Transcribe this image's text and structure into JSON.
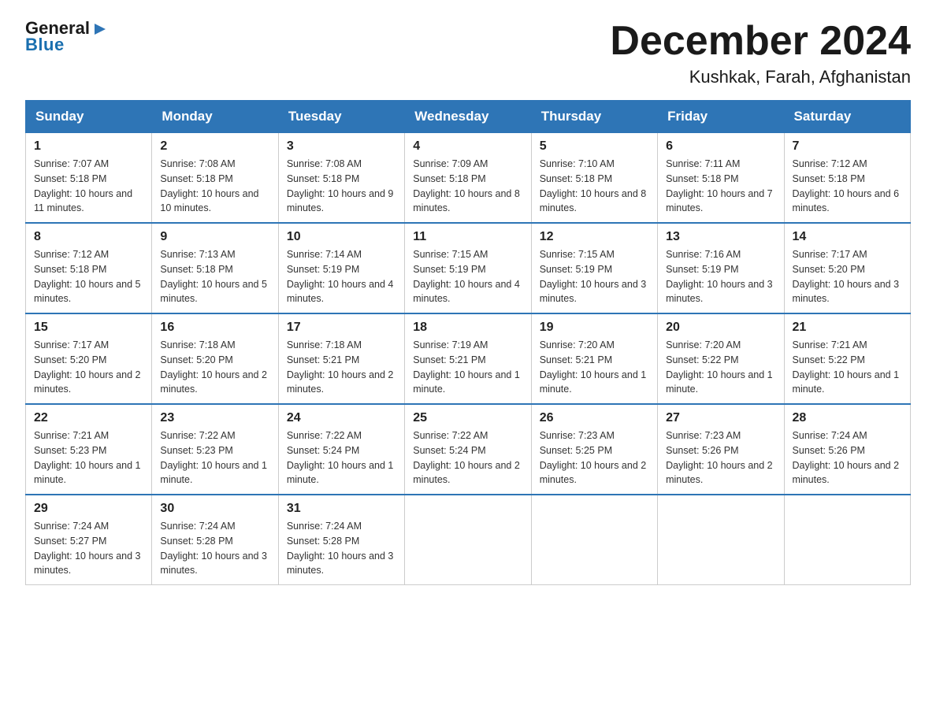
{
  "logo": {
    "name_top": "General",
    "triangle": "▶",
    "name_bottom": "Blue"
  },
  "title": "December 2024",
  "subtitle": "Kushkak, Farah, Afghanistan",
  "days_of_week": [
    "Sunday",
    "Monday",
    "Tuesday",
    "Wednesday",
    "Thursday",
    "Friday",
    "Saturday"
  ],
  "weeks": [
    [
      {
        "day": "1",
        "sunrise": "7:07 AM",
        "sunset": "5:18 PM",
        "daylight": "10 hours and 11 minutes."
      },
      {
        "day": "2",
        "sunrise": "7:08 AM",
        "sunset": "5:18 PM",
        "daylight": "10 hours and 10 minutes."
      },
      {
        "day": "3",
        "sunrise": "7:08 AM",
        "sunset": "5:18 PM",
        "daylight": "10 hours and 9 minutes."
      },
      {
        "day": "4",
        "sunrise": "7:09 AM",
        "sunset": "5:18 PM",
        "daylight": "10 hours and 8 minutes."
      },
      {
        "day": "5",
        "sunrise": "7:10 AM",
        "sunset": "5:18 PM",
        "daylight": "10 hours and 8 minutes."
      },
      {
        "day": "6",
        "sunrise": "7:11 AM",
        "sunset": "5:18 PM",
        "daylight": "10 hours and 7 minutes."
      },
      {
        "day": "7",
        "sunrise": "7:12 AM",
        "sunset": "5:18 PM",
        "daylight": "10 hours and 6 minutes."
      }
    ],
    [
      {
        "day": "8",
        "sunrise": "7:12 AM",
        "sunset": "5:18 PM",
        "daylight": "10 hours and 5 minutes."
      },
      {
        "day": "9",
        "sunrise": "7:13 AM",
        "sunset": "5:18 PM",
        "daylight": "10 hours and 5 minutes."
      },
      {
        "day": "10",
        "sunrise": "7:14 AM",
        "sunset": "5:19 PM",
        "daylight": "10 hours and 4 minutes."
      },
      {
        "day": "11",
        "sunrise": "7:15 AM",
        "sunset": "5:19 PM",
        "daylight": "10 hours and 4 minutes."
      },
      {
        "day": "12",
        "sunrise": "7:15 AM",
        "sunset": "5:19 PM",
        "daylight": "10 hours and 3 minutes."
      },
      {
        "day": "13",
        "sunrise": "7:16 AM",
        "sunset": "5:19 PM",
        "daylight": "10 hours and 3 minutes."
      },
      {
        "day": "14",
        "sunrise": "7:17 AM",
        "sunset": "5:20 PM",
        "daylight": "10 hours and 3 minutes."
      }
    ],
    [
      {
        "day": "15",
        "sunrise": "7:17 AM",
        "sunset": "5:20 PM",
        "daylight": "10 hours and 2 minutes."
      },
      {
        "day": "16",
        "sunrise": "7:18 AM",
        "sunset": "5:20 PM",
        "daylight": "10 hours and 2 minutes."
      },
      {
        "day": "17",
        "sunrise": "7:18 AM",
        "sunset": "5:21 PM",
        "daylight": "10 hours and 2 minutes."
      },
      {
        "day": "18",
        "sunrise": "7:19 AM",
        "sunset": "5:21 PM",
        "daylight": "10 hours and 1 minute."
      },
      {
        "day": "19",
        "sunrise": "7:20 AM",
        "sunset": "5:21 PM",
        "daylight": "10 hours and 1 minute."
      },
      {
        "day": "20",
        "sunrise": "7:20 AM",
        "sunset": "5:22 PM",
        "daylight": "10 hours and 1 minute."
      },
      {
        "day": "21",
        "sunrise": "7:21 AM",
        "sunset": "5:22 PM",
        "daylight": "10 hours and 1 minute."
      }
    ],
    [
      {
        "day": "22",
        "sunrise": "7:21 AM",
        "sunset": "5:23 PM",
        "daylight": "10 hours and 1 minute."
      },
      {
        "day": "23",
        "sunrise": "7:22 AM",
        "sunset": "5:23 PM",
        "daylight": "10 hours and 1 minute."
      },
      {
        "day": "24",
        "sunrise": "7:22 AM",
        "sunset": "5:24 PM",
        "daylight": "10 hours and 1 minute."
      },
      {
        "day": "25",
        "sunrise": "7:22 AM",
        "sunset": "5:24 PM",
        "daylight": "10 hours and 2 minutes."
      },
      {
        "day": "26",
        "sunrise": "7:23 AM",
        "sunset": "5:25 PM",
        "daylight": "10 hours and 2 minutes."
      },
      {
        "day": "27",
        "sunrise": "7:23 AM",
        "sunset": "5:26 PM",
        "daylight": "10 hours and 2 minutes."
      },
      {
        "day": "28",
        "sunrise": "7:24 AM",
        "sunset": "5:26 PM",
        "daylight": "10 hours and 2 minutes."
      }
    ],
    [
      {
        "day": "29",
        "sunrise": "7:24 AM",
        "sunset": "5:27 PM",
        "daylight": "10 hours and 3 minutes."
      },
      {
        "day": "30",
        "sunrise": "7:24 AM",
        "sunset": "5:28 PM",
        "daylight": "10 hours and 3 minutes."
      },
      {
        "day": "31",
        "sunrise": "7:24 AM",
        "sunset": "5:28 PM",
        "daylight": "10 hours and 3 minutes."
      },
      null,
      null,
      null,
      null
    ]
  ]
}
